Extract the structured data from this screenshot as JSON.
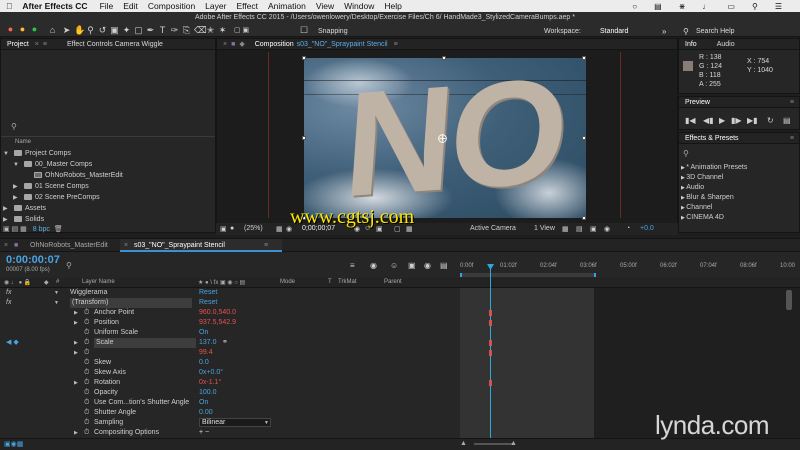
{
  "menubar": {
    "app": "After Effects CC",
    "items": [
      "File",
      "Edit",
      "Composition",
      "Layer",
      "Effect",
      "Animation",
      "View",
      "Window",
      "Help"
    ]
  },
  "toolbar": {
    "window_title": "Adobe After Effects CC 2015 - /Users/owenlowery/Desktop/Exercise Files/Ch 6/ HandMade3_StylizedCameraBumps.aep *",
    "snapping": "Snapping",
    "workspace_label": "Workspace:",
    "workspace_value": "Standard",
    "search_help": "Search Help"
  },
  "project_panel": {
    "tab_project": "Project",
    "tab_effect_controls": "Effect Controls Camera Wiggle",
    "search_placeholder": "",
    "col_name": "Name",
    "items": [
      {
        "label": "Project Comps",
        "indent": 0,
        "kind": "folder",
        "open": true
      },
      {
        "label": "00_Master Comps",
        "indent": 1,
        "kind": "folder",
        "open": true
      },
      {
        "label": "OhNoRobots_MasterEdit",
        "indent": 2,
        "kind": "comp",
        "open": false
      },
      {
        "label": "01 Scene Comps",
        "indent": 1,
        "kind": "folder",
        "open": false
      },
      {
        "label": "02 Scene PreComps",
        "indent": 1,
        "kind": "folder",
        "open": false
      },
      {
        "label": "Assets",
        "indent": 0,
        "kind": "folder",
        "open": false
      },
      {
        "label": "Solids",
        "indent": 0,
        "kind": "folder",
        "open": false
      }
    ],
    "bpc": "8 bpc"
  },
  "composition": {
    "tab_label": "Composition",
    "comp_name": "s03_\"NO\"_Spraypaint Stencil",
    "stencil_text": "NO",
    "zoom": "(25%)",
    "timecode": "0;00;00;07",
    "camera": "Active Camera",
    "views": "1 View",
    "offset": "+0.0"
  },
  "info_panel": {
    "tab_info": "Info",
    "tab_audio": "Audio",
    "r": "R : 138",
    "g": "G : 124",
    "b": "B : 118",
    "a": "A : 255",
    "x": "X : 754",
    "y": "Y : 1040",
    "swatch_color": "#8a7c76"
  },
  "preview_panel": {
    "title": "Preview"
  },
  "effects_panel": {
    "title": "Effects & Presets",
    "items": [
      "* Animation Presets",
      "3D Channel",
      "Audio",
      "Blur & Sharpen",
      "Channel",
      "CINEMA 4D"
    ]
  },
  "timeline": {
    "tab_master": "OhNoRobots_MasterEdit",
    "tab_active": "s03_\"NO\"_Spraypaint Stencil",
    "timecode": "0:00:00:07",
    "frame_info": "00007 (8.00 fps)",
    "col_layer_name": "Layer Name",
    "col_mode": "Mode",
    "col_t": "T",
    "col_trkmat": "TrkMat",
    "col_parent": "Parent",
    "ruler": [
      "0:00f",
      "01:02f",
      "02:04f",
      "03:06f",
      "05:00f",
      "06:02f",
      "07:04f",
      "08:06f",
      "10:00"
    ],
    "rows": [
      {
        "label": "Wigglerama",
        "value": "Reset",
        "value_color": "blue",
        "indent": 64,
        "tri": true,
        "fx": true
      },
      {
        "label": "(Transform)",
        "value": "Reset",
        "value_color": "blue",
        "indent": 64,
        "tri": true,
        "fx": true,
        "highlight": true
      },
      {
        "label": "Anchor Point",
        "value": "960.0,540.0",
        "value_color": "red",
        "indent": 84,
        "tri": true
      },
      {
        "label": "Position",
        "value": "937.5,542.9",
        "value_color": "red",
        "indent": 84,
        "tri": true
      },
      {
        "label": "Uniform Scale",
        "value": "On",
        "value_color": "blue",
        "indent": 84,
        "tri": false
      },
      {
        "label": "Scale",
        "value": "137.0",
        "value_color": "blue",
        "indent": 84,
        "tri": true,
        "selected": true
      },
      {
        "label": "",
        "value": "99.4",
        "value_color": "red",
        "indent": 84,
        "tri": true
      },
      {
        "label": "Skew",
        "value": "0.0",
        "value_color": "blue",
        "indent": 84,
        "tri": false
      },
      {
        "label": "Skew Axis",
        "value": "0x+0.0°",
        "value_color": "blue",
        "indent": 84,
        "tri": false
      },
      {
        "label": "Rotation",
        "value": "0x-1.1°",
        "value_color": "red",
        "indent": 84,
        "tri": true
      },
      {
        "label": "Opacity",
        "value": "100.0",
        "value_color": "blue",
        "indent": 84,
        "tri": false
      },
      {
        "label": "Use Com...tion's Shutter Angle",
        "value": "On",
        "value_color": "blue",
        "indent": 84,
        "tri": false
      },
      {
        "label": "Shutter Angle",
        "value": "0.00",
        "value_color": "blue",
        "indent": 84,
        "tri": false
      },
      {
        "label": "Sampling",
        "value": "Bilinear",
        "value_color": "white",
        "indent": 84,
        "tri": false
      },
      {
        "label": "Compositing Options",
        "value": "+ −",
        "value_color": "white",
        "indent": 84,
        "tri": true
      }
    ]
  },
  "watermark": "www.cgtsj.com",
  "lynda": "lynda.com"
}
